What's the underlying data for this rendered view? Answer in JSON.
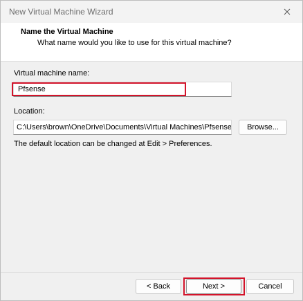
{
  "window": {
    "title": "New Virtual Machine Wizard"
  },
  "header": {
    "title": "Name the Virtual Machine",
    "subtitle": "What name would you like to use for this virtual machine?"
  },
  "form": {
    "vm_name_label": "Virtual machine name:",
    "vm_name_value": "Pfsense",
    "location_label": "Location:",
    "location_value": "C:\\Users\\brown\\OneDrive\\Documents\\Virtual Machines\\Pfsense",
    "browse_label": "Browse...",
    "hint": "The default location can be changed at Edit > Preferences."
  },
  "footer": {
    "back_label": "< Back",
    "next_label": "Next >",
    "cancel_label": "Cancel"
  },
  "colors": {
    "highlight": "#d3132a"
  }
}
